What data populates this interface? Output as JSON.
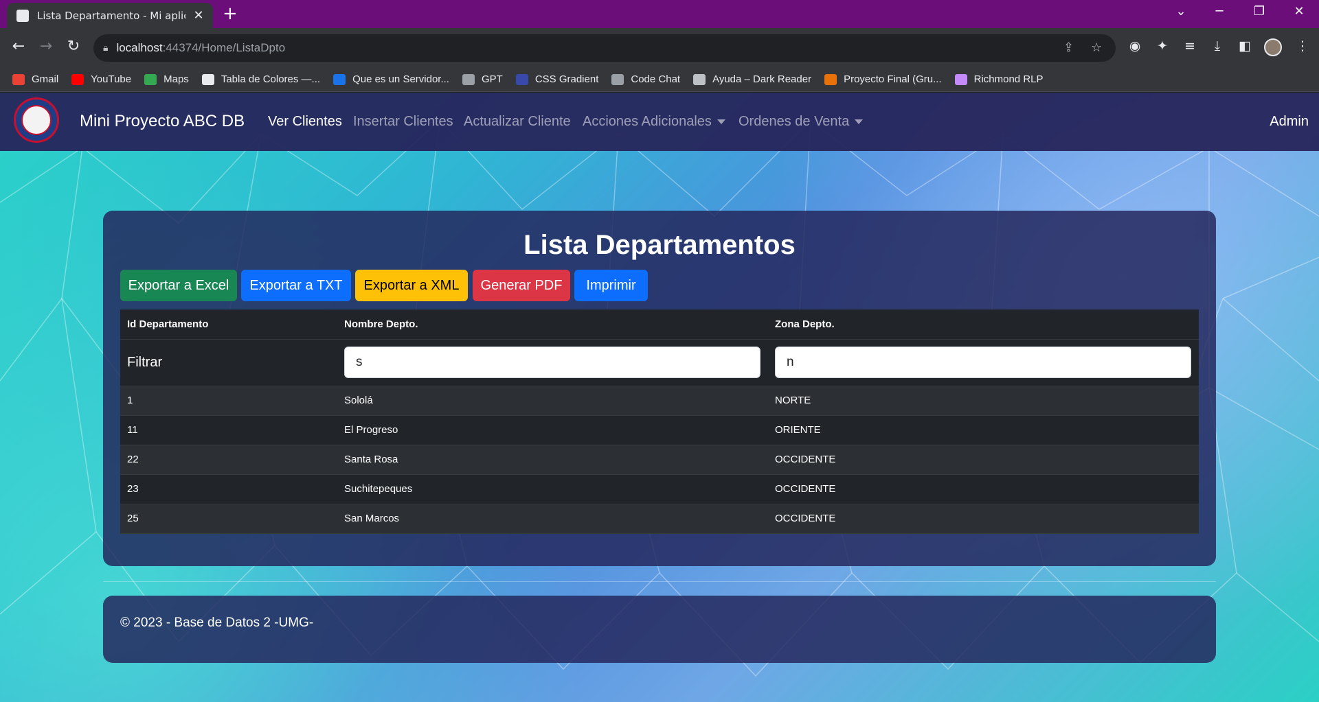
{
  "browser": {
    "tab_title": "Lista Departamento - Mi aplicación",
    "new_tab_symbol": "+",
    "url_host": "localhost",
    "url_rest": ":44374/Home/ListaDpto",
    "bookmarks": [
      {
        "label": "Gmail",
        "icon": "gmail-icon",
        "color": "#ea4335"
      },
      {
        "label": "YouTube",
        "icon": "youtube-icon",
        "color": "#ff0000"
      },
      {
        "label": "Maps",
        "icon": "maps-icon",
        "color": "#34a853"
      },
      {
        "label": "Tabla de Colores —...",
        "icon": "colors-icon",
        "color": "#e8eaed"
      },
      {
        "label": "Que es un Servidor...",
        "icon": "t-icon",
        "color": "#1a73e8"
      },
      {
        "label": "GPT",
        "icon": "gpt-icon",
        "color": "#9aa0a6"
      },
      {
        "label": "CSS Gradient",
        "icon": "gradient-icon",
        "color": "#3949ab"
      },
      {
        "label": "Code Chat",
        "icon": "codechat-icon",
        "color": "#9aa0a6"
      },
      {
        "label": "Ayuda – Dark Reader",
        "icon": "darkreader-icon",
        "color": "#bdc1c6"
      },
      {
        "label": "Proyecto Final (Gru...",
        "icon": "proyecto-icon",
        "color": "#e8710a"
      },
      {
        "label": "Richmond RLP",
        "icon": "richmond-icon",
        "color": "#c58af9"
      }
    ]
  },
  "navbar": {
    "brand": "Mini Proyecto ABC DB",
    "links": [
      "Ver Clientes",
      "Insertar Clientes",
      "Actualizar Cliente",
      "Acciones Adicionales",
      "Ordenes de Venta"
    ],
    "user": "Admin"
  },
  "main": {
    "title": "Lista Departamentos",
    "buttons": [
      "Exportar a Excel",
      "Exportar a TXT",
      "Exportar a XML",
      "Generar PDF",
      "Imprimir"
    ],
    "table": {
      "headers": [
        "Id Departamento",
        "Nombre Depto.",
        "Zona Depto."
      ],
      "filter_label": "Filtrar",
      "filter_nombre": "s",
      "filter_zona": "n",
      "rows": [
        [
          "1",
          "Sololá",
          "NORTE"
        ],
        [
          "11",
          "El Progreso",
          "ORIENTE"
        ],
        [
          "22",
          "Santa Rosa",
          "OCCIDENTE"
        ],
        [
          "23",
          "Suchitepeques",
          "OCCIDENTE"
        ],
        [
          "25",
          "San Marcos",
          "OCCIDENTE"
        ]
      ]
    }
  },
  "footer": {
    "text": "© 2023 - Base de Datos 2 -UMG-"
  }
}
